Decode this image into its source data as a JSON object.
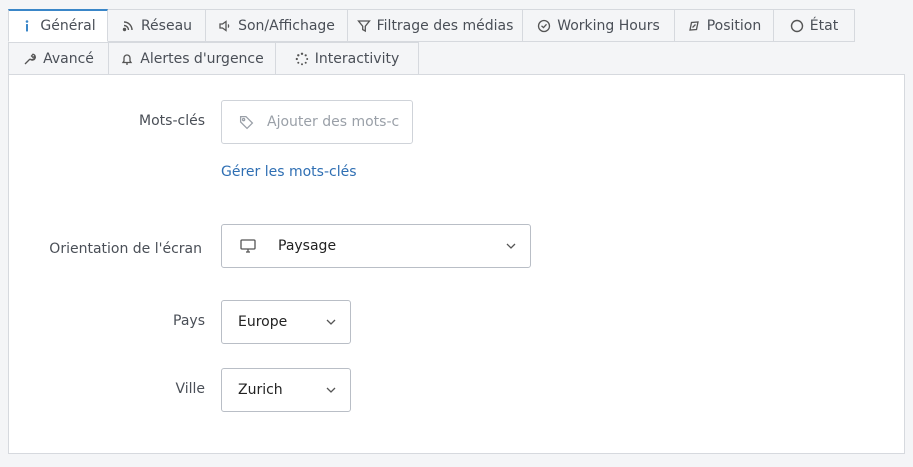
{
  "tabs": [
    {
      "label": "Général",
      "icon": "info-icon",
      "active": true
    },
    {
      "label": "Réseau",
      "icon": "rss-icon"
    },
    {
      "label": "Son/Affichage",
      "icon": "speaker-icon"
    },
    {
      "label": "Filtrage des médias",
      "icon": "filter-icon"
    },
    {
      "label": "Working Hours",
      "icon": "clock-icon"
    },
    {
      "label": "Position",
      "icon": "compass-icon"
    },
    {
      "label": "État",
      "icon": "circle-icon"
    },
    {
      "label": "Avancé",
      "icon": "wrench-icon"
    },
    {
      "label": "Alertes d'urgence",
      "icon": "bell-icon"
    },
    {
      "label": "Interactivity",
      "icon": "spinner-icon"
    }
  ],
  "form": {
    "keywords": {
      "label": "Mots-clés",
      "placeholder": "Ajouter des mots-c",
      "manage_link": "Gérer les mots-clés"
    },
    "orientation": {
      "label": "Orientation de l'écran",
      "value": "Paysage"
    },
    "country": {
      "label": "Pays",
      "value": "Europe"
    },
    "city": {
      "label": "Ville",
      "value": "Zurich"
    }
  },
  "colors": {
    "accent": "#3a86c8",
    "link": "#2f6fb3"
  }
}
